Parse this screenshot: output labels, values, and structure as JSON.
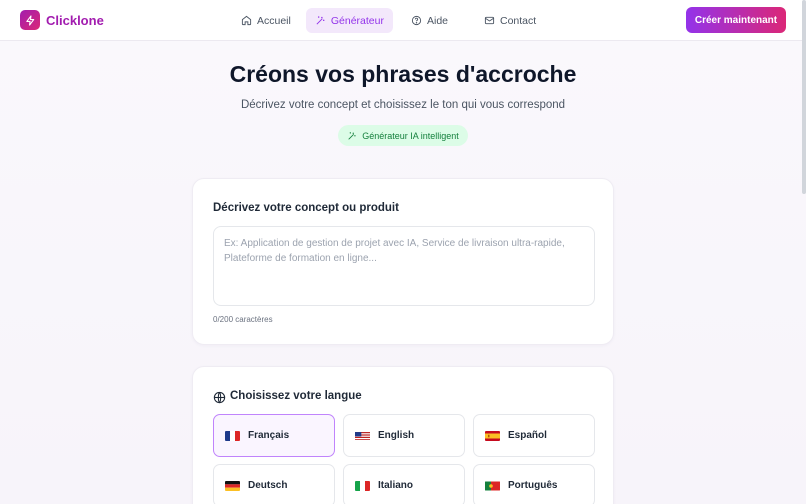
{
  "header": {
    "brand": "Clicklone",
    "nav": [
      {
        "label": "Accueil",
        "icon": "home-icon",
        "active": false
      },
      {
        "label": "Générateur",
        "icon": "magic-wand-icon",
        "active": true
      },
      {
        "label": "Aide",
        "icon": "help-circle-icon",
        "active": false
      },
      {
        "label": "Contact",
        "icon": "mail-icon",
        "active": false
      }
    ],
    "cta_label": "Créer maintenant"
  },
  "hero": {
    "title": "Créons vos phrases d'accroche",
    "subtitle": "Décrivez votre concept et choisissez le ton qui vous correspond",
    "badge": "Générateur IA intelligent"
  },
  "concept": {
    "title": "Décrivez votre concept ou produit",
    "placeholder": "Ex: Application de gestion de projet avec IA, Service de livraison ultra-rapide, Plateforme de formation en ligne...",
    "value": "",
    "counter": "0/200 caractères"
  },
  "language": {
    "title": "Choisissez votre langue",
    "options": [
      {
        "label": "Français",
        "flag": "fr-flag",
        "selected": true
      },
      {
        "label": "English",
        "flag": "us-flag",
        "selected": false
      },
      {
        "label": "Español",
        "flag": "es-flag",
        "selected": false
      },
      {
        "label": "Deutsch",
        "flag": "de-flag",
        "selected": false
      },
      {
        "label": "Italiano",
        "flag": "it-flag",
        "selected": false
      },
      {
        "label": "Português",
        "flag": "pt-flag",
        "selected": false
      }
    ]
  },
  "colors": {
    "accent": "#9333ea",
    "accent2": "#db2777",
    "badge_bg": "#dcfce7",
    "badge_text": "#15803d"
  }
}
